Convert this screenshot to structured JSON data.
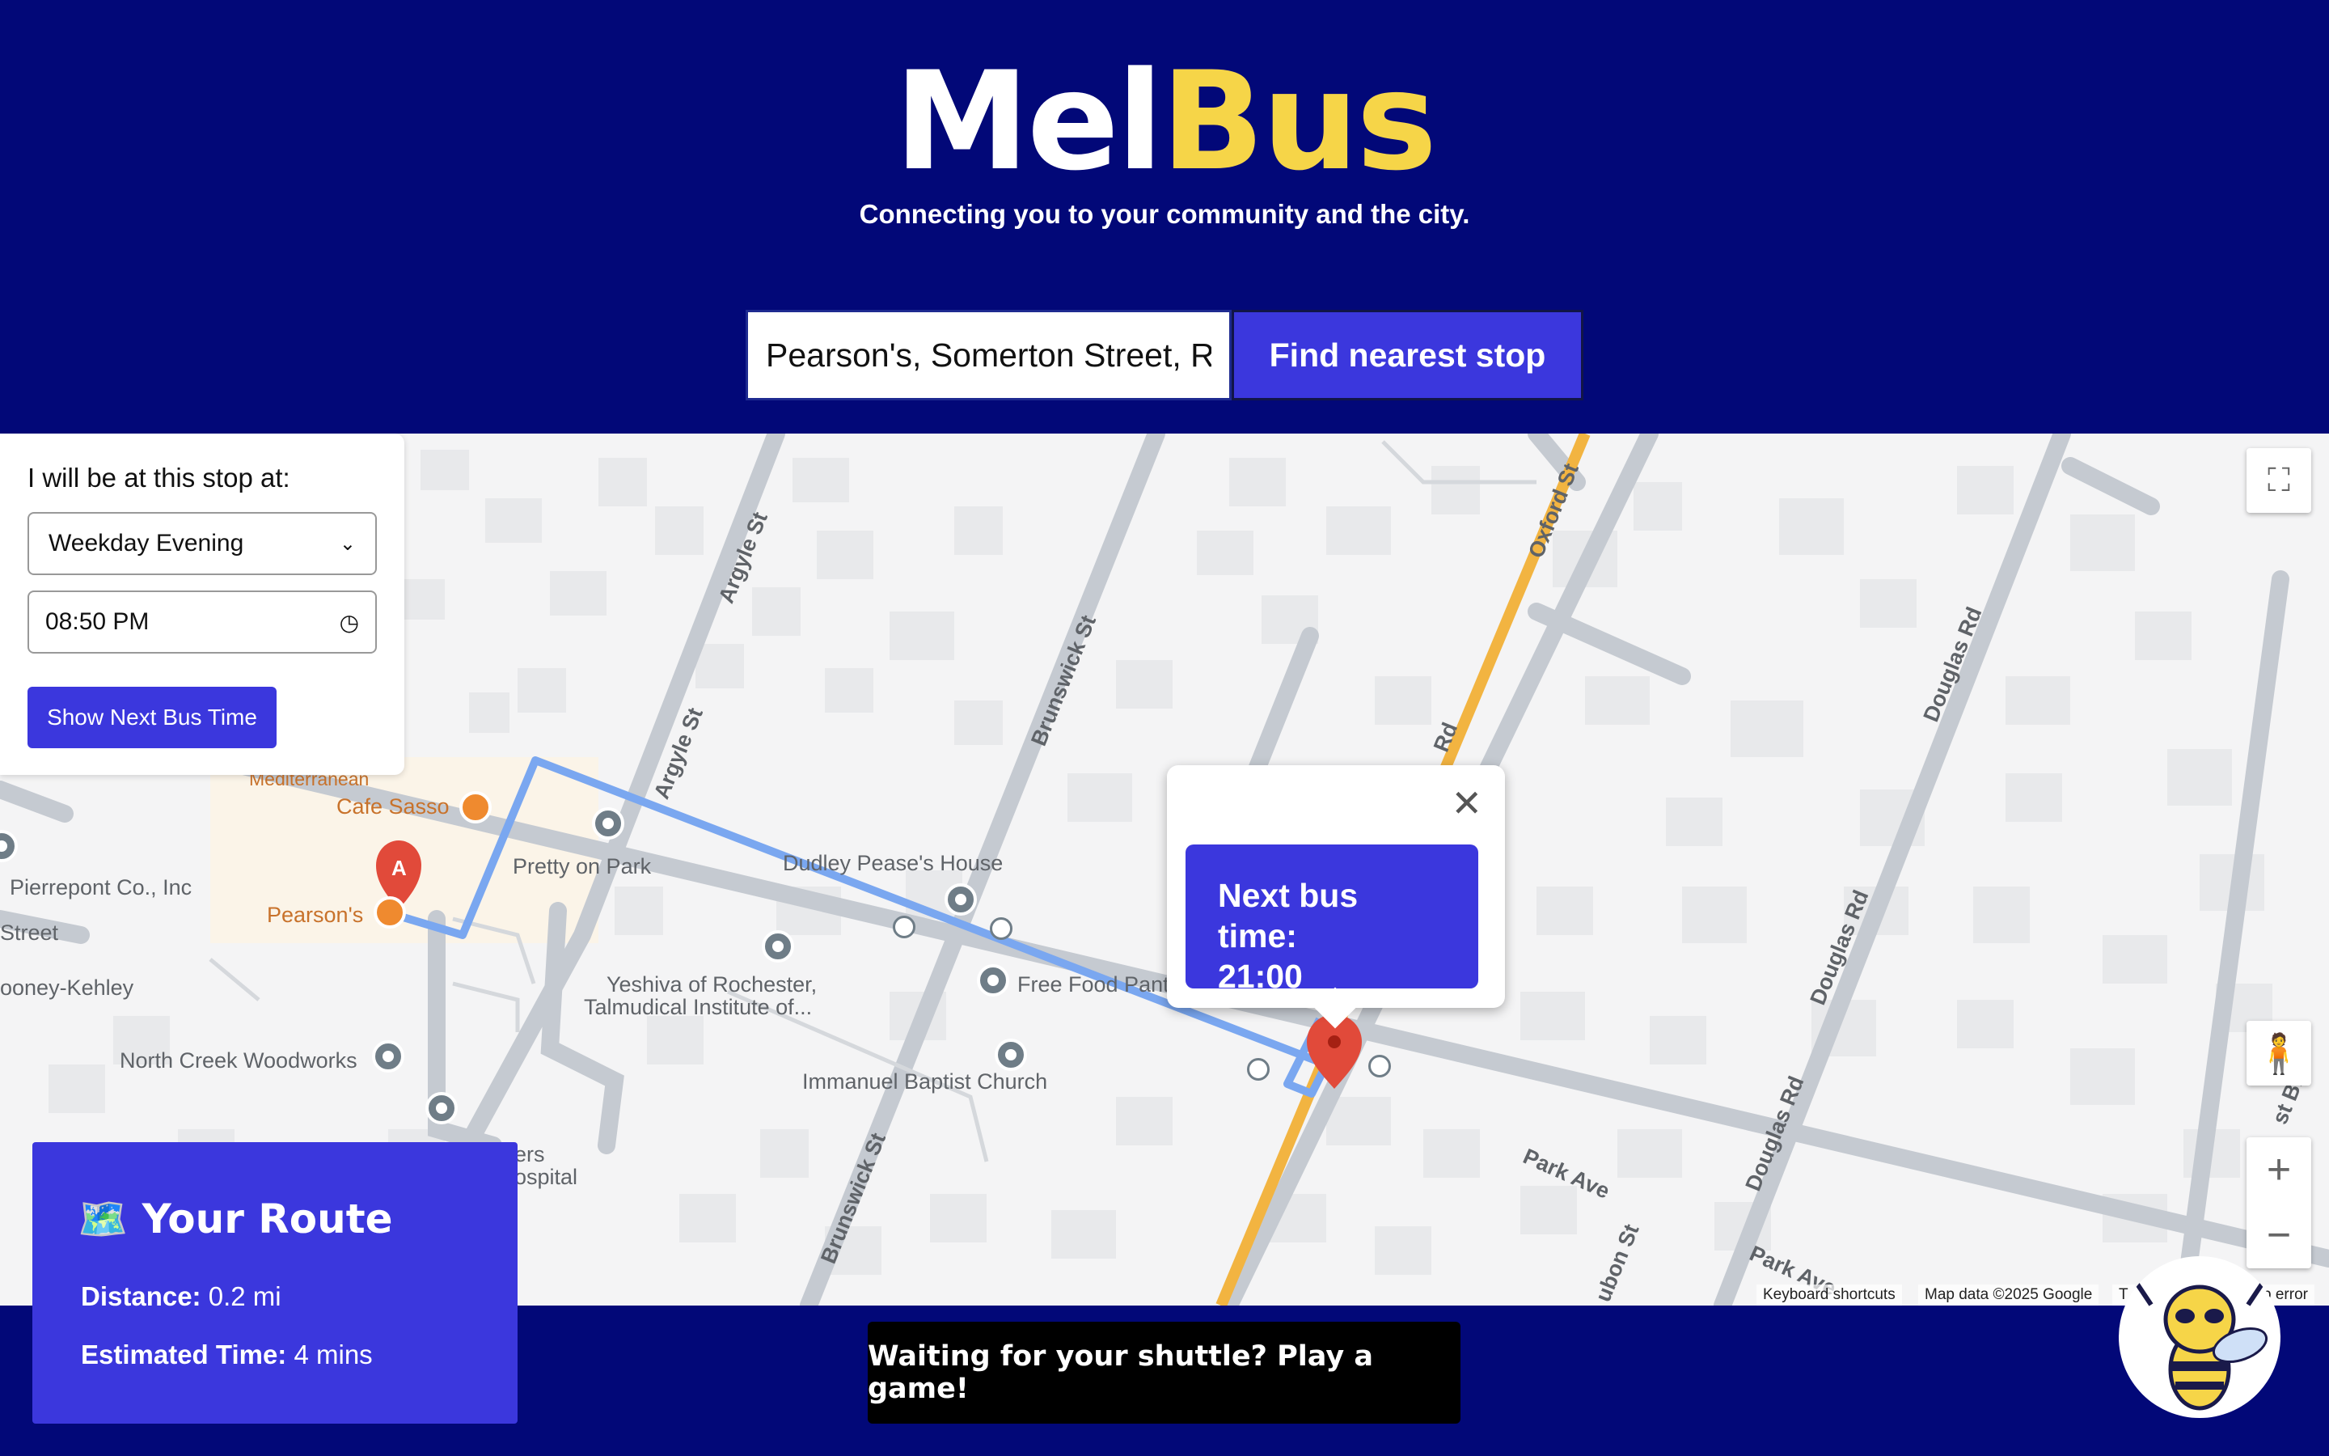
{
  "header": {
    "logo_part1": "Mel",
    "logo_part2": "Bus",
    "tagline": "Connecting you to your community and the city.",
    "search_value": "Pearson's, Somerton Street, Rochester, NY",
    "search_button": "Find nearest stop"
  },
  "stop_panel": {
    "label": "I will be at this stop at:",
    "schedule_selected": "Weekday Evening",
    "time_value": "08:50 PM",
    "show_button": "Show Next Bus Time"
  },
  "popup": {
    "line1": "Next bus time:",
    "line2": "21:00"
  },
  "route": {
    "title": "🗺️ Your Route",
    "distance_label": "Distance:",
    "distance_value": "0.2 mi",
    "time_label": "Estimated Time:",
    "time_value": "4 mins"
  },
  "game_button": "Waiting for your shuttle? Play a game!",
  "map": {
    "places": {
      "mediterranean": "Mediterranean",
      "cafe_sasso": "Cafe Sasso",
      "pierrepont": "Pierrepont Co., Inc",
      "street": "Street",
      "pearsons": "Pearson's",
      "ooney": "ooney-Kehley",
      "pretty_on_park": "Pretty on Park",
      "dudley": "Dudley Pease's House",
      "yeshiva1": "Yeshiva of Rochester,",
      "yeshiva2": "Talmudical Institute of...",
      "free_food": "Free Food Pant",
      "north_creek": "North Creek Woodworks",
      "immanuel": "Immanuel Baptist Church",
      "ers": "ers",
      "ospital": "ospital"
    },
    "roads": {
      "argyle1": "Argyle St",
      "argyle2": "Argyle St",
      "brunswick1": "Brunswick St",
      "brunswick2": "Brunswick St",
      "oxford": "Oxford St",
      "douglas1": "Douglas Rd",
      "douglas2": "Douglas Rd",
      "douglas3": "Douglas Rd",
      "park1": "Park Ave",
      "park2": "Park Ave",
      "rd": "Rd",
      "aubon": "ubon St",
      "east": "st Bl"
    },
    "marker_label": "A",
    "attribution": {
      "shortcuts": "Keyboard shortcuts",
      "data": "Map data ©2025 Google",
      "terms": "T",
      "report": "p error"
    }
  },
  "colors": {
    "brand_navy": "#020878",
    "brand_yellow": "#f6d548",
    "accent_blue": "#3b37dd",
    "route_line": "#7aa7f0",
    "major_road": "#f2b441"
  }
}
